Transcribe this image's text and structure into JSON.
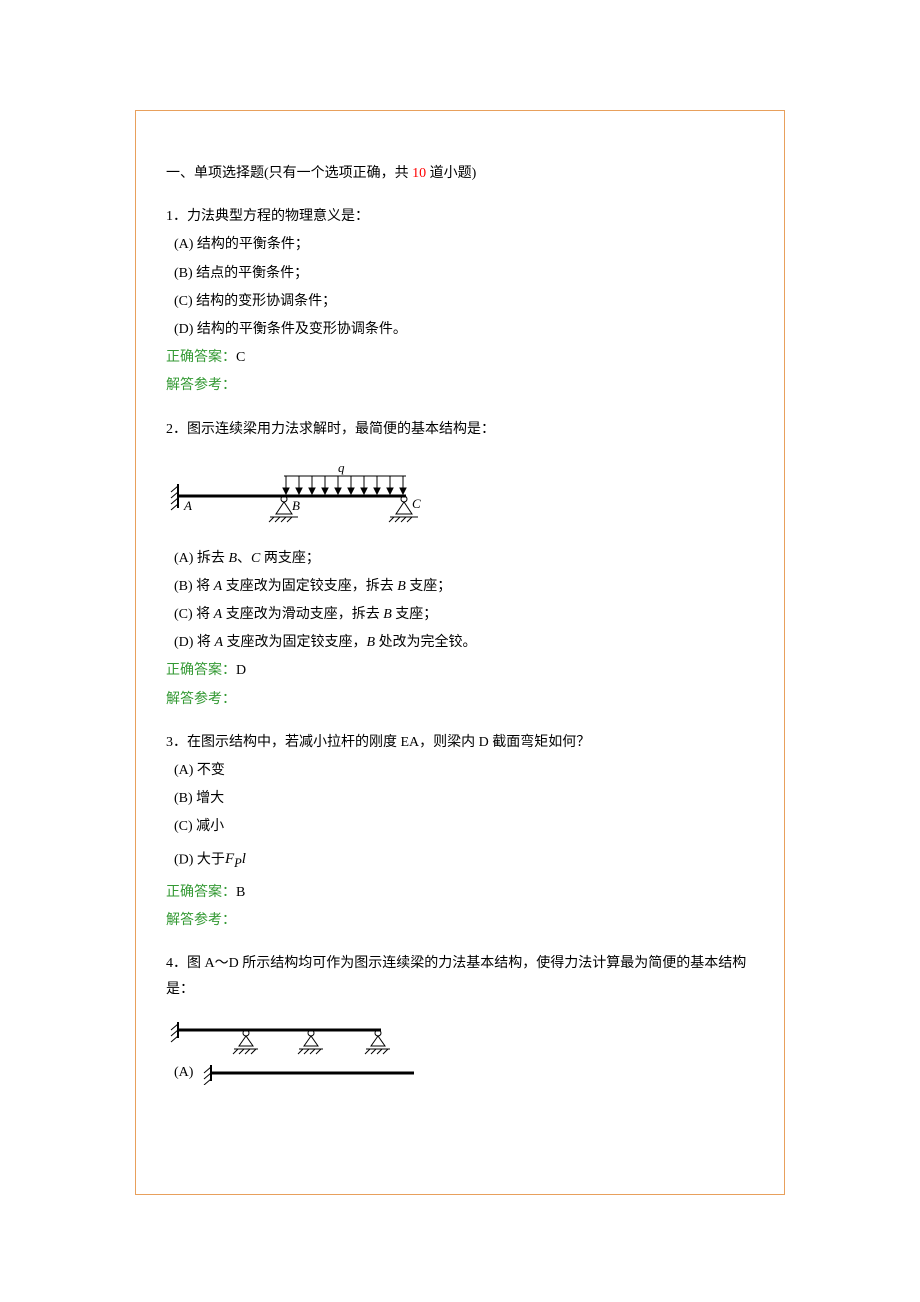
{
  "section": {
    "title_prefix": "一、单项选择题(只有一个选项正确，共 ",
    "title_count": "10",
    "title_suffix": " 道小题)"
  },
  "q1": {
    "stem": "1．力法典型方程的物理意义是：",
    "optA": "(A) 结构的平衡条件；",
    "optB": "(B) 结点的平衡条件；",
    "optC": "(C) 结构的变形协调条件；",
    "optD": "(D) 结构的平衡条件及变形协调条件。",
    "answer_label": "正确答案：",
    "answer_val": "C",
    "explain_label": "解答参考："
  },
  "q2": {
    "stem": "2．图示连续梁用力法求解时，最简便的基本结构是：",
    "diagram": {
      "load_label": "q",
      "pt_A": "A",
      "pt_B": "B",
      "pt_C": "C"
    },
    "optA_pre": "(A) 拆去 ",
    "optA_i1": "B",
    "optA_mid": "、",
    "optA_i2": "C",
    "optA_post": " 两支座；",
    "optB_pre": "(B) 将 ",
    "optB_i1": "A",
    "optB_mid": " 支座改为固定铰支座，拆去 ",
    "optB_i2": "B",
    "optB_post": " 支座；",
    "optC_pre": "(C) 将 ",
    "optC_i1": "A",
    "optC_mid": " 支座改为滑动支座，拆去 ",
    "optC_i2": "B",
    "optC_post": " 支座；",
    "optD_pre": "(D) 将 ",
    "optD_i1": "A",
    "optD_mid": " 支座改为固定铰支座，",
    "optD_i2": "B",
    "optD_post": " 处改为完全铰。",
    "answer_label": "正确答案：",
    "answer_val": "D",
    "explain_label": "解答参考："
  },
  "q3": {
    "stem": "3．在图示结构中，若减小拉杆的刚度 EA，则梁内 D 截面弯矩如何？",
    "optA": "(A) 不变",
    "optB": "(B) 增大",
    "optC": "(C) 减小",
    "optD_pre": "(D) 大于",
    "optD_formula": "F",
    "optD_formula_sub": "P",
    "optD_formula_post": "l",
    "answer_label": "正确答案：",
    "answer_val": "B",
    "explain_label": "解答参考："
  },
  "q4": {
    "stem": "4．图 A～D 所示结构均可作为图示连续梁的力法基本结构，使得力法计算最为简便的基本结构是：",
    "optA_label": "(A)"
  }
}
